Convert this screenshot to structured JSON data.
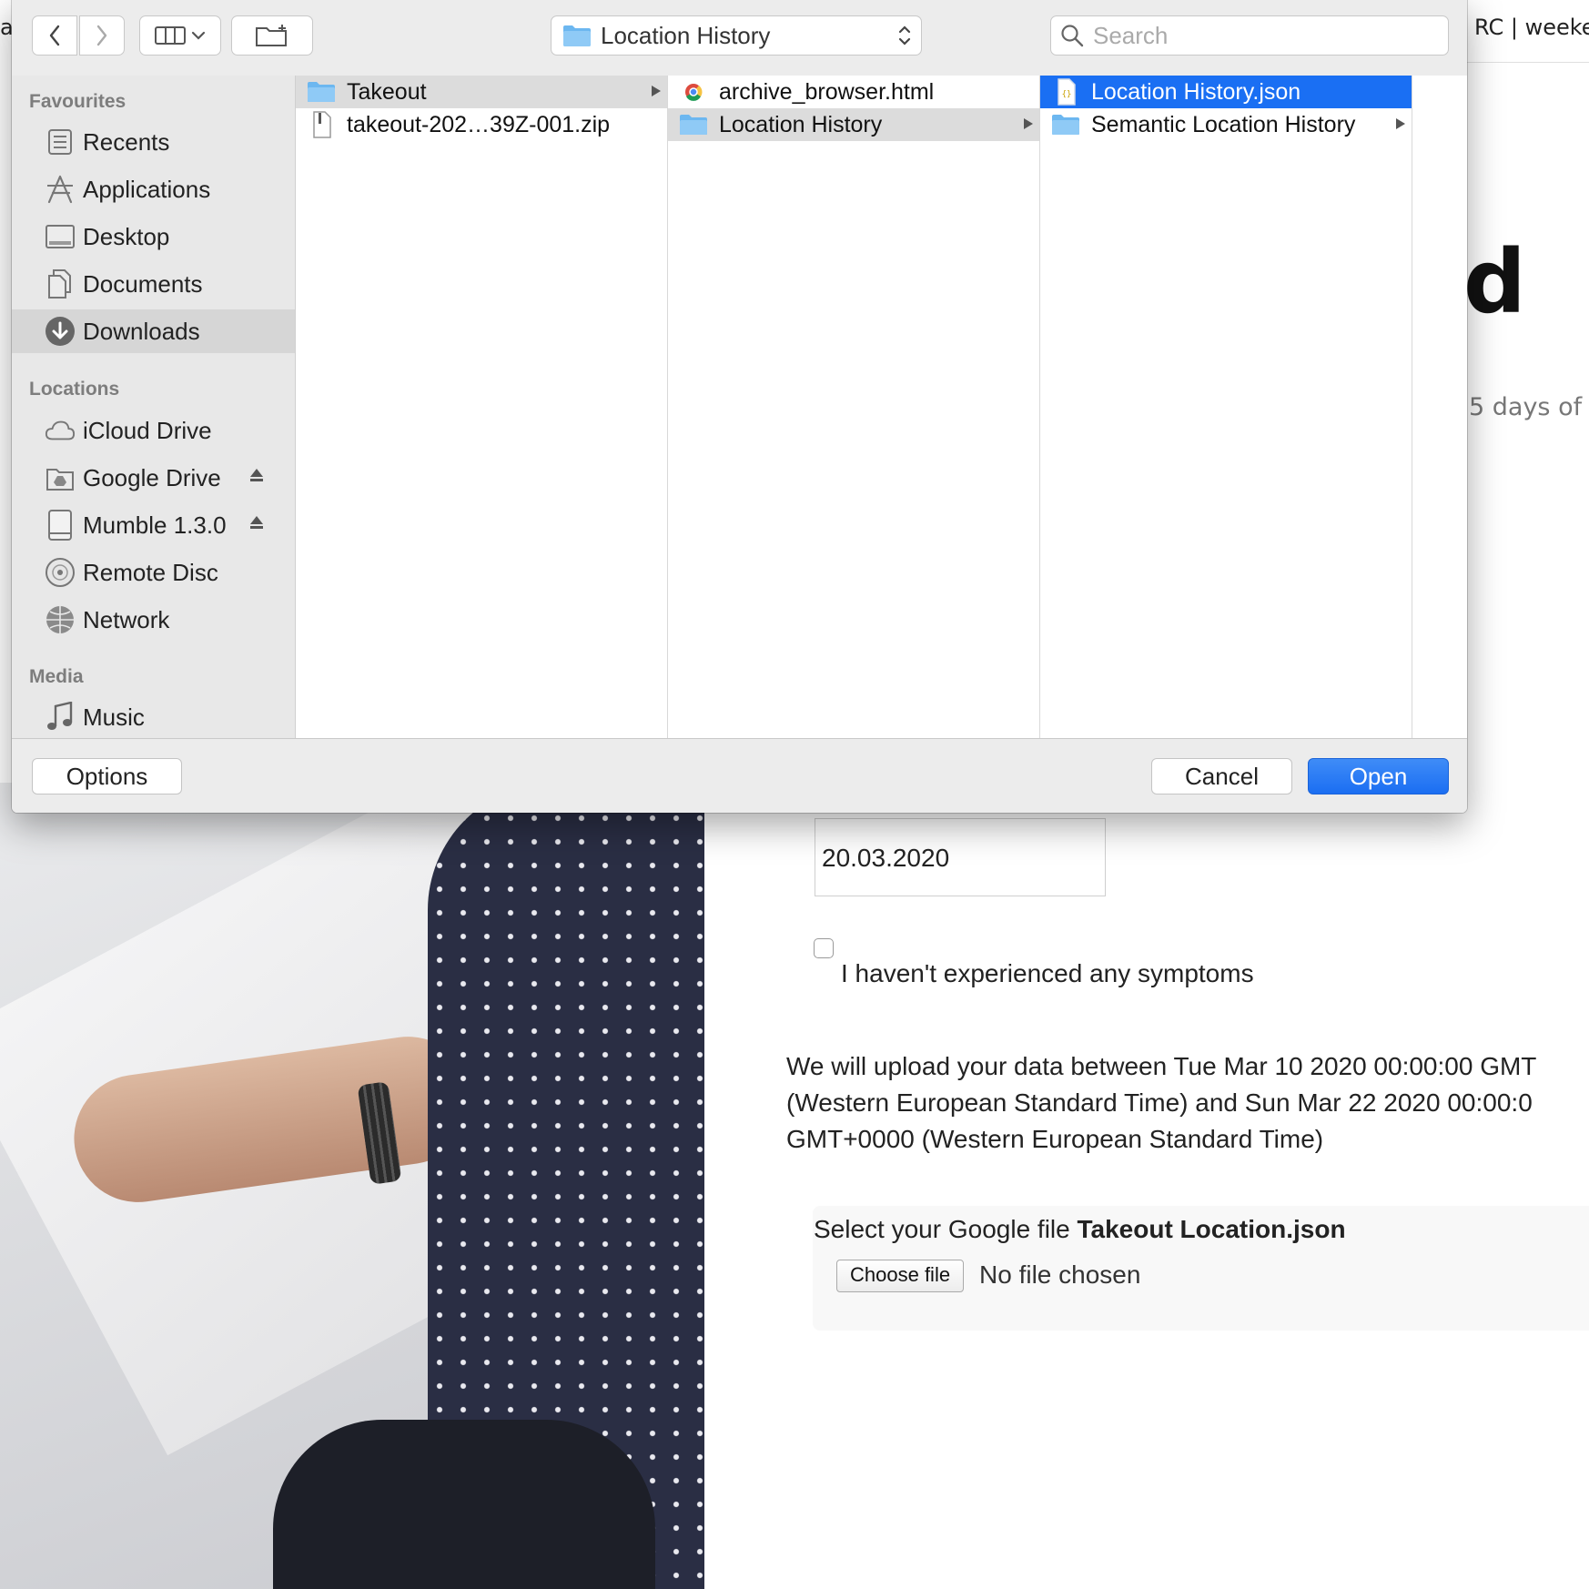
{
  "background": {
    "tab_left_fragment": "a",
    "tab_title": "RC | weeke",
    "heading_fragment": "d",
    "subtitle_fragment": "5 days of",
    "date_value": "20.03.2020",
    "symptom_label": "I haven't experienced any symptoms",
    "upload_text": "We will upload your data between Tue Mar 10 2020 00:00:00 GMT\n(Western European Standard Time) and Sun Mar 22 2020 00:00:0\nGMT+0000 (Western European Standard Time)",
    "file_prompt_prefix": "Select your Google file",
    "file_prompt_bold": "Takeout Location.json",
    "choose_file_label": "Choose file",
    "no_file_text": "No file chosen"
  },
  "dialog": {
    "path_popup": {
      "label": "Location History",
      "icon": "folder-icon"
    },
    "search": {
      "placeholder": "Search",
      "value": ""
    },
    "sidebar": {
      "favourites_header": "Favourites",
      "favourites": [
        {
          "label": "Recents",
          "icon": "recents-icon"
        },
        {
          "label": "Applications",
          "icon": "applications-icon"
        },
        {
          "label": "Desktop",
          "icon": "desktop-icon"
        },
        {
          "label": "Documents",
          "icon": "documents-icon"
        },
        {
          "label": "Downloads",
          "icon": "downloads-icon",
          "selected": true
        }
      ],
      "locations_header": "Locations",
      "locations": [
        {
          "label": "iCloud Drive",
          "icon": "cloud-icon"
        },
        {
          "label": "Google Drive",
          "icon": "google-drive-icon",
          "ejectable": true
        },
        {
          "label": "Mumble 1.3.0",
          "icon": "disk-icon",
          "ejectable": true
        },
        {
          "label": "Remote Disc",
          "icon": "disc-icon"
        },
        {
          "label": "Network",
          "icon": "network-icon"
        }
      ],
      "media_header": "Media",
      "media": [
        {
          "label": "Music",
          "icon": "music-icon"
        }
      ]
    },
    "columns": [
      [
        {
          "name": "Takeout",
          "icon": "folder-icon",
          "folder": true,
          "state": "highlighted"
        },
        {
          "name": "takeout-202…39Z-001.zip",
          "icon": "zip-file-icon",
          "folder": false
        }
      ],
      [
        {
          "name": "archive_browser.html",
          "icon": "chrome-html-icon",
          "folder": false
        },
        {
          "name": "Location History",
          "icon": "folder-icon",
          "folder": true,
          "state": "highlighted"
        }
      ],
      [
        {
          "name": "Location History.json",
          "icon": "json-file-icon",
          "folder": false,
          "state": "selected"
        },
        {
          "name": "Semantic Location History",
          "icon": "folder-icon",
          "folder": true
        }
      ]
    ],
    "buttons": {
      "options": "Options",
      "cancel": "Cancel",
      "open": "Open"
    },
    "colors": {
      "accent": "#1a6ff3",
      "folder": "#6cb7f0"
    }
  }
}
